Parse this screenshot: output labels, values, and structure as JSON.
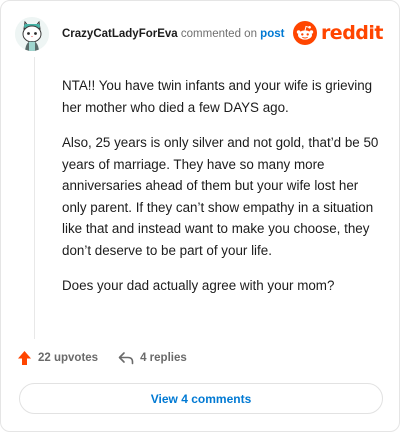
{
  "header": {
    "username": "CrazyCatLadyForEva",
    "action_text": "commented on",
    "post_link": "post",
    "brand": "reddit"
  },
  "comment": {
    "paragraphs": [
      "NTA!! You have twin infants and your wife is grieving her mother who died a few DAYS ago.",
      "Also, 25 years is only silver and not gold, that’d be 50 years of marriage. They have so many more anniversaries ahead of them but your wife lost her only parent. If they can’t show empathy in a situation like that and instead want to make you choose, they don’t deserve to be part of your life.",
      "Does your dad actually agree with your mom?"
    ]
  },
  "actions": {
    "upvotes": "22 upvotes",
    "replies": "4 replies"
  },
  "footer": {
    "view_comments": "View 4 comments"
  },
  "colors": {
    "brand": "#ff4500",
    "link": "#0079d3",
    "upvote_arrow": "#ff4500"
  },
  "icons": [
    "avatar-cat-icon",
    "reddit-logo-icon",
    "upvote-arrow-icon",
    "reply-arrow-icon"
  ]
}
